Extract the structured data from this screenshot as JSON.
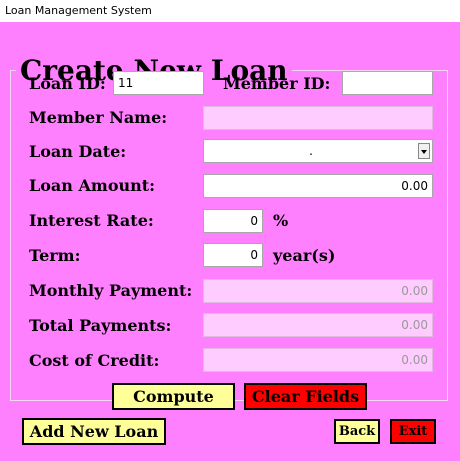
{
  "window": {
    "title": "Loan Management System"
  },
  "form": {
    "heading": "Create New Loan",
    "fields": {
      "loan_id": {
        "label": "Loan ID:",
        "value": "11"
      },
      "member_id": {
        "label": "Member ID:",
        "value": ""
      },
      "member_name": {
        "label": "Member Name:",
        "value": ""
      },
      "loan_date": {
        "label": "Loan Date:",
        "value": "."
      },
      "loan_amount": {
        "label": "Loan Amount:",
        "value": "0.00"
      },
      "interest_rate": {
        "label": "Interest Rate:",
        "value": "0",
        "unit": "%"
      },
      "term": {
        "label": "Term:",
        "value": "0",
        "unit": "year(s)"
      },
      "monthly_payment": {
        "label": "Monthly Payment:",
        "value": "0.00"
      },
      "total_payments": {
        "label": "Total Payments:",
        "value": "0.00"
      },
      "cost_of_credit": {
        "label": "Cost of Credit:",
        "value": "0.00"
      }
    }
  },
  "buttons": {
    "compute": "Compute",
    "clear_fields": "Clear Fields",
    "add_new_loan": "Add New Loan",
    "back": "Back",
    "exit": "Exit"
  },
  "colors": {
    "background": "#ff80ff",
    "readonly_field": "#ffccff",
    "button_yellow": "#ffff99",
    "button_red": "#ff0000"
  }
}
